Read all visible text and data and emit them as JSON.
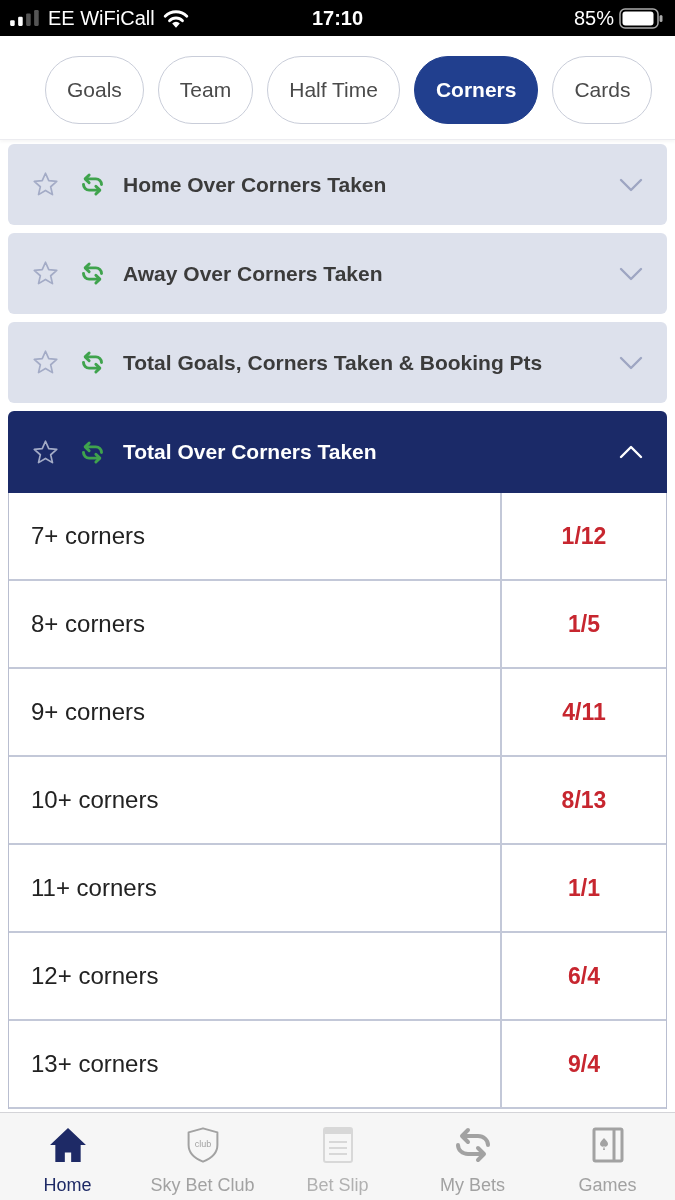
{
  "status_bar": {
    "carrier": "EE WiFiCall",
    "time": "17:10",
    "battery": "85%"
  },
  "tabs": [
    {
      "label": "Goals",
      "selected": false
    },
    {
      "label": "Team",
      "selected": false
    },
    {
      "label": "Half Time",
      "selected": false
    },
    {
      "label": "Corners",
      "selected": true
    },
    {
      "label": "Cards",
      "selected": false
    }
  ],
  "markets": [
    {
      "title": "Home Over Corners Taken",
      "favourite": false,
      "expanded": false
    },
    {
      "title": "Away Over Corners Taken",
      "favourite": false,
      "expanded": false
    },
    {
      "title": "Total Goals, Corners Taken & Booking Pts",
      "favourite": false,
      "expanded": false
    },
    {
      "title": "Total Over Corners Taken",
      "favourite": false,
      "expanded": true,
      "selections": [
        {
          "label": "7+ corners",
          "odds": "1/12"
        },
        {
          "label": "8+ corners",
          "odds": "1/5"
        },
        {
          "label": "9+ corners",
          "odds": "4/11"
        },
        {
          "label": "10+ corners",
          "odds": "8/13"
        },
        {
          "label": "11+ corners",
          "odds": "1/1"
        },
        {
          "label": "12+ corners",
          "odds": "6/4"
        },
        {
          "label": "13+ corners",
          "odds": "9/4"
        }
      ]
    }
  ],
  "bottom_nav": [
    {
      "kind": "home",
      "label": "Home",
      "selected": true,
      "disabled": false
    },
    {
      "kind": "club",
      "label": "Sky Bet Club",
      "icon_text": "club",
      "selected": false,
      "disabled": false
    },
    {
      "kind": "slip",
      "label": "Bet Slip",
      "selected": false,
      "disabled": true
    },
    {
      "kind": "bets",
      "label": "My Bets",
      "selected": false,
      "disabled": false
    },
    {
      "kind": "games",
      "label": "Games",
      "selected": false,
      "disabled": false
    }
  ]
}
